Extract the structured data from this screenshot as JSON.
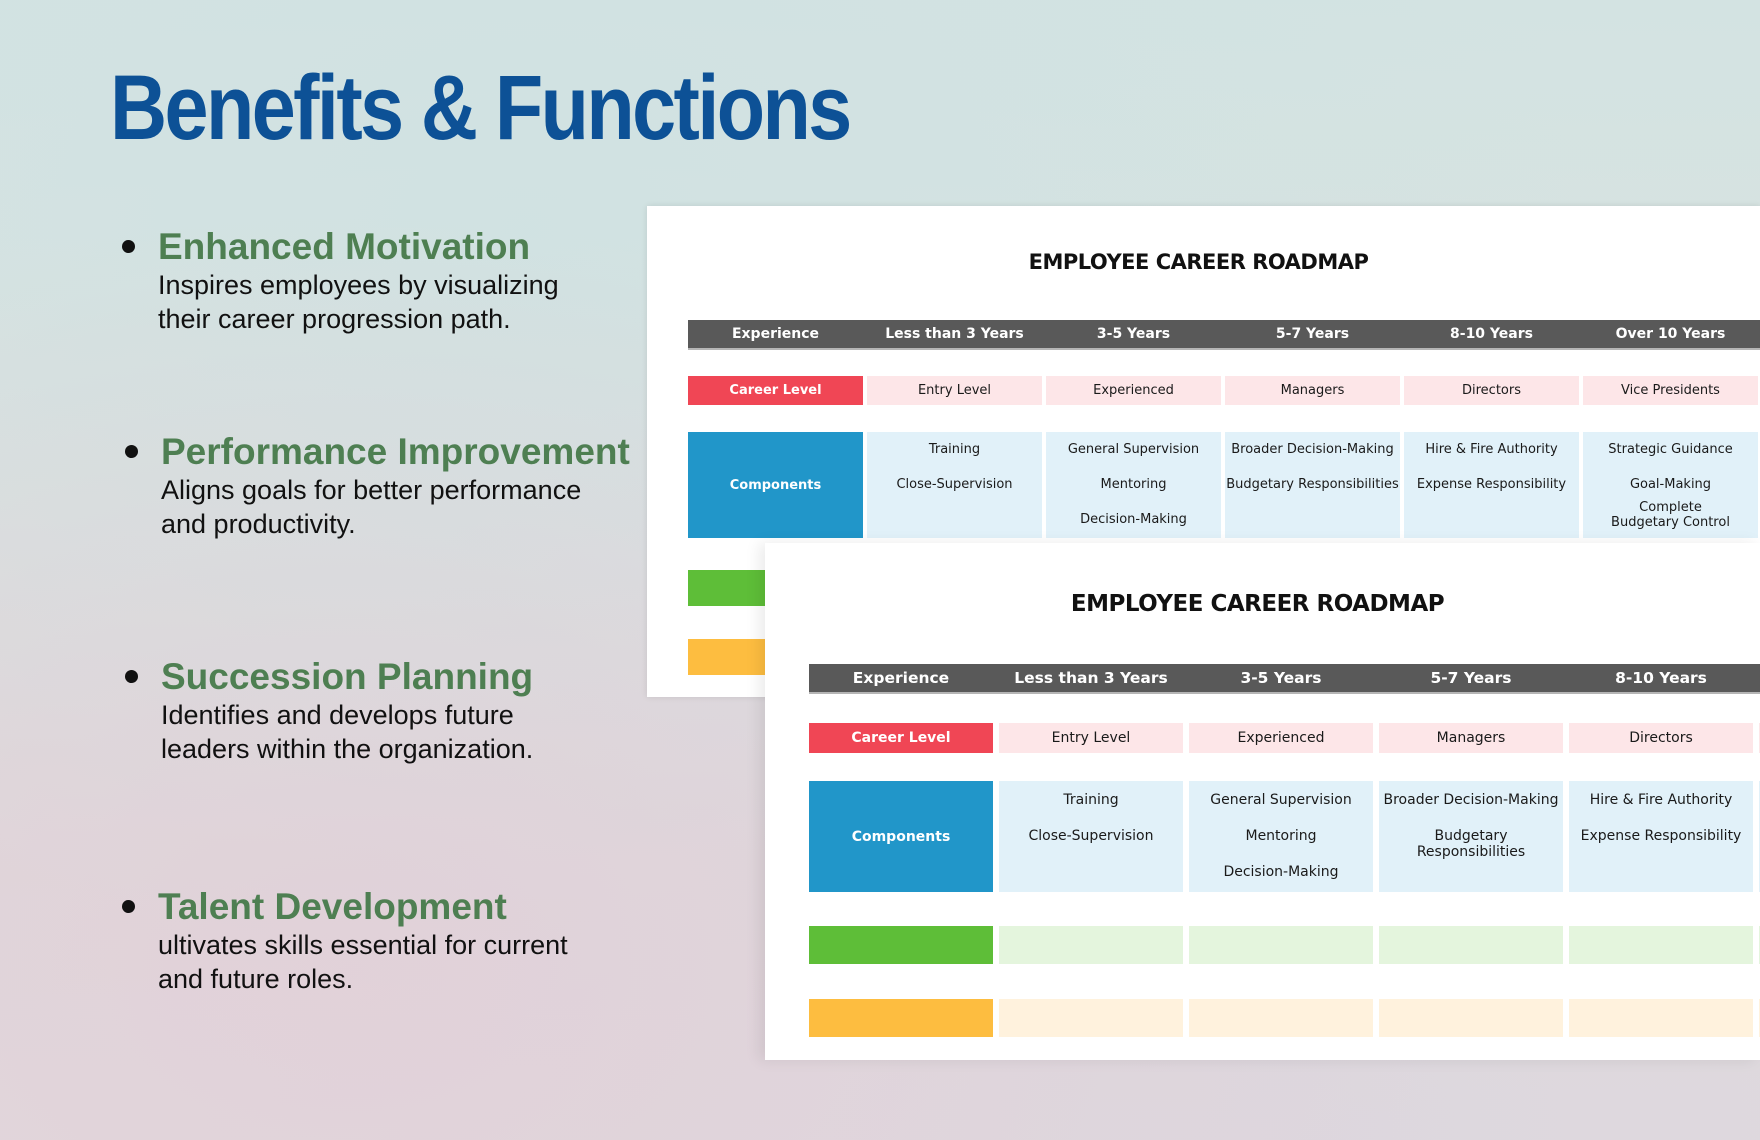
{
  "page": {
    "title": "Benefits & Functions",
    "title_color": "#0d5196"
  },
  "benefits": [
    {
      "title": "Enhanced Motivation",
      "description": "Inspires employees by visualizing their career progression path."
    },
    {
      "title": "Performance Improvement",
      "description": "Aligns goals for better performance and productivity."
    },
    {
      "title": "Succession Planning",
      "description": "Identifies and develops future leaders within the organization."
    },
    {
      "title": "Talent Development",
      "description": "ultivates skills essential for current and future roles."
    }
  ],
  "colors": {
    "benefit_title": "#4e7f52",
    "header_bar": "#595959",
    "career_level": "#f04655",
    "components": "#2196c9",
    "green_row": "#5ebe38",
    "orange_row": "#fdbd40"
  },
  "roadmap_back": {
    "title": "EMPLOYEE CAREER ROADMAP",
    "header": [
      "Experience",
      "Less than 3 Years",
      "3-5 Years",
      "5-7 Years",
      "8-10 Years",
      "Over 10 Years"
    ],
    "career_level_label": "Career Level",
    "career_levels": [
      "Entry Level",
      "Experienced",
      "Managers",
      "Directors",
      "Vice Presidents"
    ],
    "components_label": "Components",
    "components": [
      [
        "Training",
        "Close-Supervision"
      ],
      [
        "General Supervision",
        "Mentoring",
        "Decision-Making"
      ],
      [
        "Broader Decision-Making",
        "Budgetary Responsibilities"
      ],
      [
        "Hire & Fire Authority",
        "Expense Responsibility"
      ],
      [
        "Strategic Guidance",
        "Goal-Making",
        "Complete Budgetary Control"
      ]
    ]
  },
  "roadmap_front": {
    "title": "EMPLOYEE CAREER ROADMAP",
    "header": [
      "Experience",
      "Less than 3 Years",
      "3-5 Years",
      "5-7 Years",
      "8-10 Years",
      ""
    ],
    "career_level_label": "Career Level",
    "career_levels": [
      "Entry Level",
      "Experienced",
      "Managers",
      "Directors",
      ""
    ],
    "components_label": "Components",
    "components": [
      [
        "Training",
        "Close-Supervision"
      ],
      [
        "General Supervision",
        "Mentoring",
        "Decision-Making"
      ],
      [
        "Broader Decision-Making",
        "Budgetary Responsibilities"
      ],
      [
        "Hire & Fire Authority",
        "Expense Responsibility"
      ],
      []
    ]
  }
}
